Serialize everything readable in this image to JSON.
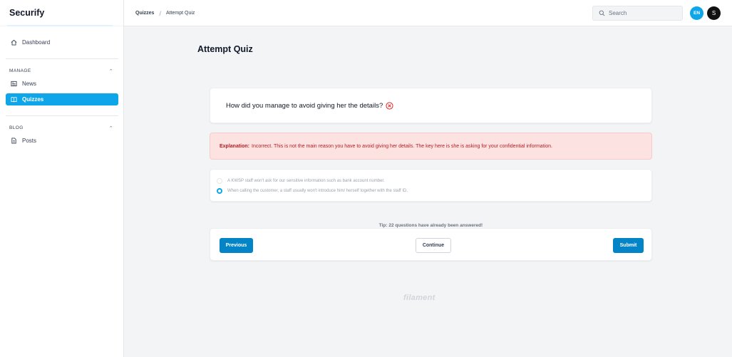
{
  "app": {
    "brand": "Securify"
  },
  "sidebar": {
    "dashboard": {
      "label": "Dashboard",
      "icon": "home-icon"
    },
    "groups": [
      {
        "label": "MANAGE",
        "items": [
          {
            "label": "News",
            "icon": "newspaper-icon"
          },
          {
            "label": "Quizzes",
            "icon": "book-open-icon",
            "active": true
          }
        ]
      },
      {
        "label": "BLOG",
        "items": [
          {
            "label": "Posts",
            "icon": "document-icon"
          }
        ]
      }
    ]
  },
  "topbar": {
    "breadcrumbs": [
      "Quizzes",
      "Attempt Quiz"
    ],
    "search_placeholder": "Search",
    "locale": "EN",
    "user_initial": "S"
  },
  "main": {
    "title": "Attempt Quiz",
    "question": "How did you manage to avoid giving her the details?",
    "explanation": {
      "label": "Explanation:",
      "text": "Incorrect. This is not the main reason you have to avoid giving her details. The key here is she is asking for your confidential information."
    },
    "options": [
      {
        "text": "A KWSP staff won't ask for our sensitive information such as bank account number.",
        "selected": false
      },
      {
        "text": "When calling the customer, a staff usually won't introduce him/ herself together with the staff ID.",
        "selected": true
      }
    ],
    "tip": "Tip: 22 questions have already been answered!",
    "buttons": {
      "previous": "Previous",
      "continue": "Continue",
      "submit": "Submit"
    }
  },
  "footer": {
    "logo_text": "filament"
  },
  "colors": {
    "accent": "#0ea5e9",
    "primary_button": "#0284c7",
    "error": "#dc2626",
    "explanation_bg": "#fde2e2"
  }
}
